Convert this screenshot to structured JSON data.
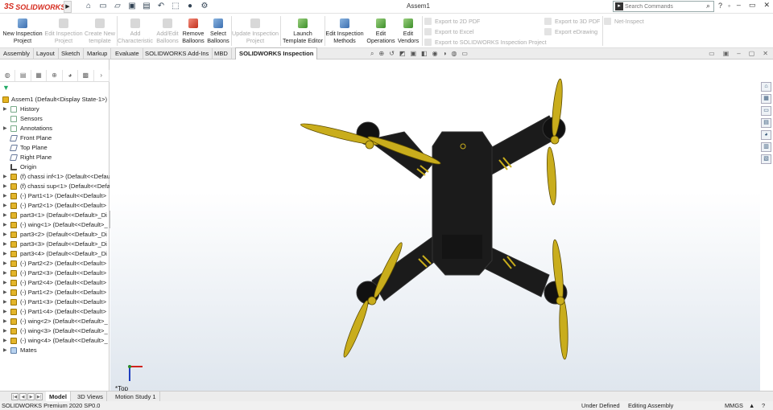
{
  "titlebar": {
    "logo_text": "SOLIDWORKS",
    "document_title": "Assem1",
    "search_placeholder": "Search Commands"
  },
  "ribbon": {
    "buttons": [
      {
        "label1": "New Inspection",
        "label2": "Project",
        "enabled": true
      },
      {
        "label1": "Edit Inspection",
        "label2": "Project",
        "enabled": false
      },
      {
        "label1": "Create New",
        "label2": "template",
        "enabled": false
      },
      {
        "label1": "Add",
        "label2": "Characteristic",
        "enabled": false
      },
      {
        "label1": "Add/Edit",
        "label2": "Balloons",
        "enabled": false
      },
      {
        "label1": "Remove",
        "label2": "Balloons",
        "enabled": true
      },
      {
        "label1": "Select",
        "label2": "Balloons",
        "enabled": true
      },
      {
        "label1": "Update Inspection",
        "label2": "Project",
        "enabled": false
      },
      {
        "label1": "Launch",
        "label2": "Template Editor",
        "enabled": true
      },
      {
        "label1": "Edit Inspection",
        "label2": "Methods",
        "enabled": true
      },
      {
        "label1": "Edit",
        "label2": "Operations",
        "enabled": true
      },
      {
        "label1": "Edit",
        "label2": "Vendors",
        "enabled": true
      }
    ],
    "exports": [
      "Export to 2D PDF",
      "Export to Excel",
      "Export to SOLIDWORKS Inspection Project",
      "Export to 3D PDF",
      "Export eDrawing",
      "Net-Inspect"
    ]
  },
  "tabs": [
    "Assembly",
    "Layout",
    "Sketch",
    "Markup",
    "Evaluate",
    "SOLIDWORKS Add-Ins",
    "MBD",
    "SOLIDWORKS Inspection"
  ],
  "active_tab": "SOLIDWORKS Inspection",
  "tree": {
    "root": "Assem1  (Default<Display State-1>)",
    "items": [
      {
        "label": "History",
        "icon": "folder"
      },
      {
        "label": "Sensors",
        "icon": "folder"
      },
      {
        "label": "Annotations",
        "icon": "folder"
      },
      {
        "label": "Front Plane",
        "icon": "plane"
      },
      {
        "label": "Top Plane",
        "icon": "plane"
      },
      {
        "label": "Right Plane",
        "icon": "plane"
      },
      {
        "label": "Origin",
        "icon": "origin"
      },
      {
        "label": "(f) chassi inf<1> (Default<<Defau",
        "icon": "part"
      },
      {
        "label": "(f) chassi sup<1> (Default<<Defa",
        "icon": "part"
      },
      {
        "label": "(-) Part1<1> (Default<<Default>",
        "icon": "part"
      },
      {
        "label": "(-) Part2<1> (Default<<Default>",
        "icon": "part"
      },
      {
        "label": "part3<1> (Default<<Default>_Di",
        "icon": "part"
      },
      {
        "label": "(-) wing<1> (Default<<Default>_",
        "icon": "part"
      },
      {
        "label": "part3<2> (Default<<Default>_Di",
        "icon": "part"
      },
      {
        "label": "part3<3> (Default<<Default>_Di",
        "icon": "part"
      },
      {
        "label": "part3<4> (Default<<Default>_Di",
        "icon": "part"
      },
      {
        "label": "(-) Part2<2> (Default<<Default>",
        "icon": "part"
      },
      {
        "label": "(-) Part2<3> (Default<<Default>",
        "icon": "part"
      },
      {
        "label": "(-) Part2<4> (Default<<Default>",
        "icon": "part"
      },
      {
        "label": "(-) Part1<2> (Default<<Default>",
        "icon": "part"
      },
      {
        "label": "(-) Part1<3> (Default<<Default>",
        "icon": "part"
      },
      {
        "label": "(-) Part1<4> (Default<<Default>",
        "icon": "part"
      },
      {
        "label": "(-) wing<2> (Default<<Default>_",
        "icon": "part"
      },
      {
        "label": "(-) wing<3> (Default<<Default>_",
        "icon": "part"
      },
      {
        "label": "(-) wing<4> (Default<<Default>_",
        "icon": "part"
      },
      {
        "label": "Mates",
        "icon": "mates"
      }
    ]
  },
  "viewport": {
    "view_label": "*Top"
  },
  "bottom_tabs": [
    "Model",
    "3D Views",
    "Motion Study 1"
  ],
  "status": {
    "product": "SOLIDWORKS Premium 2020 SP0.0",
    "state": "Under Defined",
    "mode": "Editing Assembly",
    "units": "MMGS"
  },
  "colors": {
    "accent": "#2d83c9",
    "brand": "#d52b1e",
    "propeller": "#c9ad1c",
    "body": "#1b1b1b"
  }
}
